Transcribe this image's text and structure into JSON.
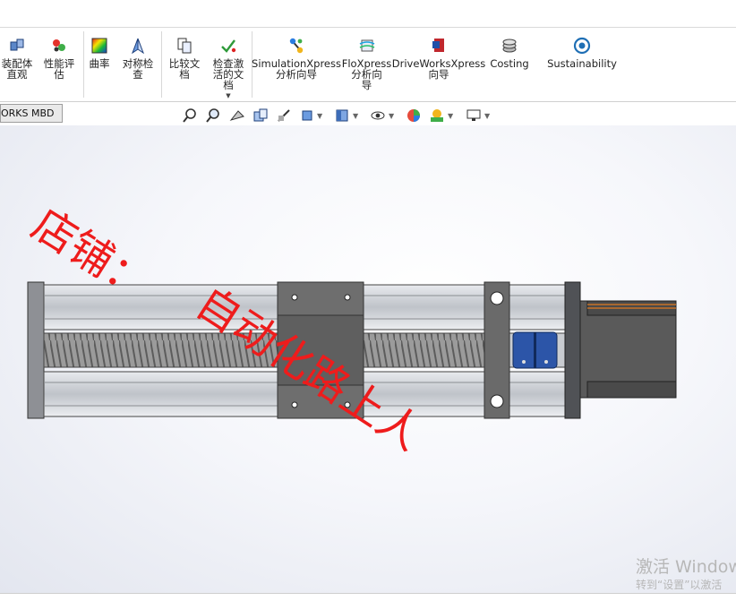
{
  "ribbon": {
    "buttons": [
      {
        "id": "assembly",
        "label": "装配体\n直观",
        "icon": "assembly-visualization-icon"
      },
      {
        "id": "perf",
        "label": "性能评\n估",
        "icon": "performance-evaluation-icon"
      },
      {
        "id": "curv",
        "label": "曲率",
        "icon": "curvature-icon"
      },
      {
        "id": "sym",
        "label": "对称检\n查",
        "icon": "symmetry-check-icon"
      },
      {
        "id": "comp",
        "label": "比较文\n档",
        "icon": "compare-documents-icon"
      },
      {
        "id": "check",
        "label": "检查激\n活的文\n档",
        "icon": "check-active-document-icon"
      },
      {
        "id": "sim",
        "label": "SimulationXpress\n分析向导",
        "icon": "simulationxpress-icon"
      },
      {
        "id": "flo",
        "label": "FloXpress\n分析向\n导",
        "icon": "floxpress-icon"
      },
      {
        "id": "drive",
        "label": "DriveWorksXpress\n向导",
        "icon": "driveworksxpress-icon"
      },
      {
        "id": "cost",
        "label": "Costing",
        "icon": "costing-icon"
      },
      {
        "id": "sust",
        "label": "Sustainability",
        "icon": "sustainability-icon"
      }
    ]
  },
  "cm_tab": {
    "label": "ORKS MBD"
  },
  "view_toolbar": [
    "zoom-to-fit-icon",
    "zoom-to-area-icon",
    "previous-view-icon",
    "section-view-icon",
    "dynamic-annotation-icon",
    "view-orientation-icon",
    "display-style-icon",
    "hide-show-items-icon",
    "edit-appearance-icon",
    "apply-scene-icon",
    "view-settings-icon"
  ],
  "watermark": {
    "line1": "店铺：",
    "line2": "自动化路上人"
  },
  "activation": {
    "title": "激活 Window",
    "subtitle": "转到“设置”以激活"
  },
  "colors": {
    "watermark": "#ee1c1c",
    "rail": "#cfd2d6",
    "carriage": "#707070",
    "coupling": "#2c55a8",
    "screw": "#8a8a8a"
  }
}
